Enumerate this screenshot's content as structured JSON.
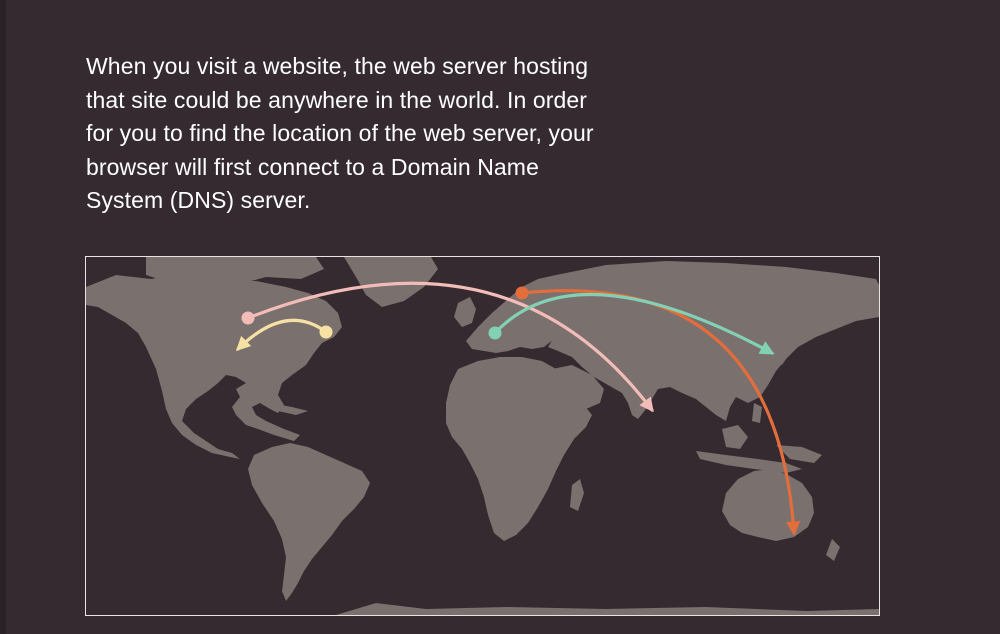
{
  "intro": {
    "text": "When you visit a website, the web server hosting that site could be anywhere in the world. In order for you to find the location of the web server, your browser will first connect to a Domain Name System (DNS) server."
  },
  "map": {
    "land_color": "#7a706e",
    "background_color": "#342a30",
    "routes": [
      {
        "from": "us-east",
        "to": "us-west",
        "color": "#f6e0a4"
      },
      {
        "from": "us-west",
        "to": "india",
        "color": "#f2bcb8"
      },
      {
        "from": "scandinavia",
        "to": "australia",
        "color": "#e46d3c"
      },
      {
        "from": "europe",
        "to": "east-asia",
        "color": "#83d1b4"
      }
    ]
  }
}
